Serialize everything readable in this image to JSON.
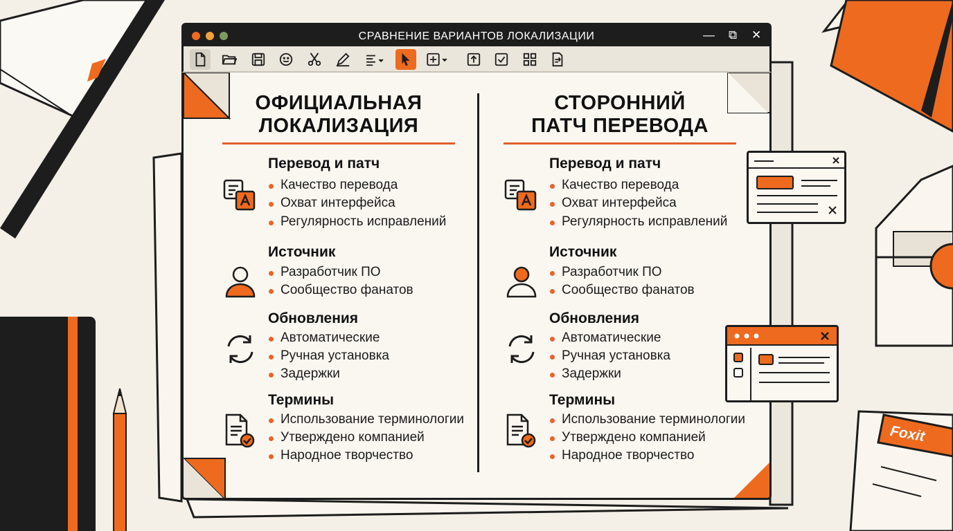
{
  "window": {
    "title": "СРАВНЕНИЕ ВАРИАНТОВ ЛОКАЛИЗАЦИИ",
    "controls": {
      "minimize": "—",
      "maximize": "⧉",
      "close": "✕"
    }
  },
  "toolbar": {
    "buttons": [
      "new-document-icon",
      "open-folder-icon",
      "save-icon",
      "emoji-icon",
      "cut-icon",
      "pen-icon",
      "align-text-icon",
      "select-pointer-icon",
      "add-box-icon",
      "upload-icon",
      "checkbox-icon",
      "grid-icon",
      "image-convert-icon"
    ],
    "active": "select-pointer-icon"
  },
  "columns": [
    {
      "title_line1": "ОФИЦИАЛЬНАЯ",
      "title_line2": "ЛОКАЛИЗАЦИЯ",
      "sections": [
        {
          "title": "Перевод и патч",
          "icon": "translate-icon",
          "items": [
            "Качество перевода",
            "Охват интерфейса",
            "Регулярность исправлений"
          ]
        },
        {
          "title": "Источник",
          "icon": "user-icon",
          "items": [
            "Разработчик ПО",
            "Сообщество фанатов"
          ]
        },
        {
          "title": "Обновления",
          "icon": "refresh-icon",
          "items": [
            "Автоматические",
            "Ручная установка",
            "Задержки"
          ]
        },
        {
          "title": "Термины",
          "icon": "document-check-icon",
          "items": [
            "Использование терминологии",
            "Утверждено компанией",
            "Народное творчество"
          ]
        }
      ]
    },
    {
      "title_line1": "СТОРОННИЙ",
      "title_line2": "ПАТЧ ПЕРЕВОДА",
      "sections": [
        {
          "title": "Перевод и патч",
          "icon": "translate-icon",
          "items": [
            "Качество перевода",
            "Охват интерфейса",
            "Регулярность исправлений"
          ]
        },
        {
          "title": "Источник",
          "icon": "user-icon",
          "items": [
            "Разработчик ПО",
            "Сообщество фанатов"
          ]
        },
        {
          "title": "Обновления",
          "icon": "refresh-icon",
          "items": [
            "Автоматические",
            "Ручная установка",
            "Задержки"
          ]
        },
        {
          "title": "Термины",
          "icon": "document-check-icon",
          "items": [
            "Использование терминологии",
            "Утверждено компанией",
            "Народное творчество"
          ]
        }
      ]
    }
  ],
  "badge": {
    "brand": "Foxit"
  },
  "colors": {
    "accent": "#ee6a1f",
    "dark": "#1d1d1d",
    "paper": "#faf7f1",
    "background": "#f4f0e8"
  }
}
